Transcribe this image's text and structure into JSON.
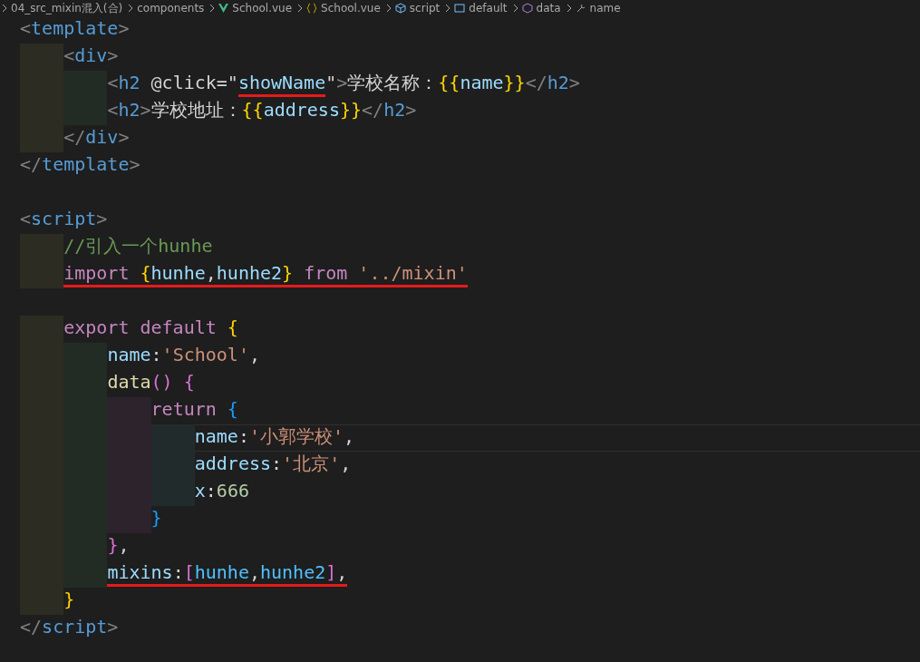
{
  "breadcrumb": [
    {
      "kind": "folder",
      "label": "04_src_mixin混入(合)"
    },
    {
      "kind": "folder",
      "label": "components"
    },
    {
      "kind": "vue",
      "label": "School.vue"
    },
    {
      "kind": "braces",
      "label": "School.vue"
    },
    {
      "kind": "module",
      "label": "script"
    },
    {
      "kind": "object",
      "label": "default"
    },
    {
      "kind": "method",
      "label": "data"
    },
    {
      "kind": "field",
      "label": "name"
    }
  ],
  "lines": [
    {
      "current": false,
      "tokens": [
        {
          "kind": "punct-tag",
          "text": "<"
        },
        {
          "kind": "tag",
          "text": "template"
        },
        {
          "kind": "punct-tag",
          "text": ">"
        }
      ],
      "children": [
        {
          "current": false,
          "tokens": [
            {
              "kind": "punct-tag",
              "text": "<"
            },
            {
              "kind": "tag",
              "text": "div"
            },
            {
              "kind": "punct-tag",
              "text": ">"
            }
          ],
          "children": [
            {
              "current": false,
              "tokens": [
                {
                  "kind": "punct-tag",
                  "text": "<",
                  "underlined": false
                },
                {
                  "kind": "tag",
                  "text": "h2 ",
                  "underlined": false
                },
                {
                  "kind": "plain",
                  "text": "@click=\"",
                  "underlined": false
                },
                {
                  "kind": "attr",
                  "text": "showName",
                  "underlined": true
                },
                {
                  "kind": "plain",
                  "text": "\"",
                  "underlined": false
                },
                {
                  "kind": "punct-tag",
                  "text": ">",
                  "underlined": false
                },
                {
                  "kind": "plain",
                  "text": "学校名称：",
                  "underlined": false
                },
                {
                  "kind": "gold",
                  "text": "{{",
                  "underlined": false
                },
                {
                  "kind": "attr",
                  "text": "name",
                  "underlined": false
                },
                {
                  "kind": "gold",
                  "text": "}}",
                  "underlined": false
                },
                {
                  "kind": "punct-tag",
                  "text": "</",
                  "underlined": false
                },
                {
                  "kind": "tag",
                  "text": "h2",
                  "underlined": false
                },
                {
                  "kind": "punct-tag",
                  "text": ">",
                  "underlined": false
                }
              ]
            },
            {
              "current": false,
              "tokens": [
                {
                  "kind": "punct-tag",
                  "text": "<"
                },
                {
                  "kind": "tag",
                  "text": "h2"
                },
                {
                  "kind": "punct-tag",
                  "text": ">"
                },
                {
                  "kind": "plain",
                  "text": "学校地址："
                },
                {
                  "kind": "gold",
                  "text": "{{"
                },
                {
                  "kind": "attr",
                  "text": "address"
                },
                {
                  "kind": "gold",
                  "text": "}}"
                },
                {
                  "kind": "punct-tag",
                  "text": "</"
                },
                {
                  "kind": "tag",
                  "text": "h2"
                },
                {
                  "kind": "punct-tag",
                  "text": ">"
                }
              ]
            }
          ]
        },
        {
          "current": false,
          "tokens": [
            {
              "kind": "punct-tag",
              "text": "</"
            },
            {
              "kind": "tag",
              "text": "div"
            },
            {
              "kind": "punct-tag",
              "text": ">"
            }
          ]
        }
      ]
    },
    {
      "current": false,
      "tokens": [
        {
          "kind": "punct-tag",
          "text": "</"
        },
        {
          "kind": "tag",
          "text": "template"
        },
        {
          "kind": "punct-tag",
          "text": ">"
        }
      ]
    },
    {
      "current": false
    },
    {
      "current": false,
      "tokens": [
        {
          "kind": "punct-tag",
          "text": "<"
        },
        {
          "kind": "tag",
          "text": "script"
        },
        {
          "kind": "punct-tag",
          "text": ">"
        }
      ],
      "children": [
        {
          "current": false,
          "tokens": [
            {
              "kind": "comment",
              "text": "//引入一个hunhe"
            }
          ]
        },
        {
          "current": false,
          "tokens": [
            {
              "kind": "keyword",
              "text": "import ",
              "underlined": true
            },
            {
              "kind": "gold",
              "text": "{",
              "underlined": true
            },
            {
              "kind": "attr",
              "text": "hunhe",
              "underlined": true
            },
            {
              "kind": "plain",
              "text": ",",
              "underlined": true
            },
            {
              "kind": "attr",
              "text": "hunhe2",
              "underlined": true
            },
            {
              "kind": "gold",
              "text": "}",
              "underlined": true
            },
            {
              "kind": "keyword",
              "text": " from ",
              "underlined": true
            },
            {
              "kind": "string",
              "text": "'../mixin'",
              "underlined": true
            }
          ]
        }
      ]
    },
    {
      "current": false
    },
    {
      "current": false,
      "tokens": [
        {
          "kind": "keyword",
          "text": "export default "
        },
        {
          "kind": "gold",
          "text": "{"
        }
      ],
      "indented": true,
      "children": [
        {
          "current": false,
          "tokens": [
            {
              "kind": "attr",
              "text": "name"
            },
            {
              "kind": "plain",
              "text": ":"
            },
            {
              "kind": "string",
              "text": "'School'"
            },
            {
              "kind": "plain",
              "text": ","
            }
          ]
        },
        {
          "current": false,
          "tokens": [
            {
              "kind": "function",
              "text": "data"
            },
            {
              "kind": "purple",
              "text": "() {"
            }
          ],
          "children": [
            {
              "current": false,
              "tokens": [
                {
                  "kind": "keyword",
                  "text": "return "
                },
                {
                  "kind": "blue",
                  "text": "{"
                }
              ],
              "children": [
                {
                  "current": true,
                  "tokens": [
                    {
                      "kind": "attr",
                      "text": "name"
                    },
                    {
                      "kind": "plain",
                      "text": ":"
                    },
                    {
                      "kind": "string",
                      "text": "'小郭学校'"
                    },
                    {
                      "kind": "plain",
                      "text": ","
                    }
                  ]
                },
                {
                  "current": false,
                  "tokens": [
                    {
                      "kind": "attr",
                      "text": "address"
                    },
                    {
                      "kind": "plain",
                      "text": ":"
                    },
                    {
                      "kind": "string",
                      "text": "'北京'"
                    },
                    {
                      "kind": "plain",
                      "text": ","
                    }
                  ]
                },
                {
                  "current": false,
                  "tokens": [
                    {
                      "kind": "attr",
                      "text": "x"
                    },
                    {
                      "kind": "plain",
                      "text": ":"
                    },
                    {
                      "kind": "number",
                      "text": "666"
                    }
                  ]
                }
              ]
            },
            {
              "current": false,
              "tokens": [
                {
                  "kind": "blue",
                  "text": "}"
                }
              ]
            }
          ]
        },
        {
          "current": false,
          "tokens": [
            {
              "kind": "purple",
              "text": "}"
            },
            {
              "kind": "plain",
              "text": ","
            }
          ]
        },
        {
          "current": false,
          "tokens": [
            {
              "kind": "attr",
              "text": "mixins",
              "underlined": true
            },
            {
              "kind": "plain",
              "text": ":",
              "underlined": true
            },
            {
              "kind": "purple",
              "text": "[",
              "underlined": true
            },
            {
              "kind": "bright",
              "text": "hunhe",
              "underlined": true
            },
            {
              "kind": "plain",
              "text": ",",
              "underlined": true
            },
            {
              "kind": "bright",
              "text": "hunhe2",
              "underlined": true
            },
            {
              "kind": "purple",
              "text": "]",
              "underlined": true
            },
            {
              "kind": "plain",
              "text": ",",
              "underlined": true
            }
          ]
        }
      ]
    },
    {
      "current": false,
      "tokens": [
        {
          "kind": "gold",
          "text": "}"
        }
      ],
      "indented": true
    },
    {
      "current": false,
      "tokens": [
        {
          "kind": "punct-tag",
          "text": "</"
        },
        {
          "kind": "tag",
          "text": "script"
        },
        {
          "kind": "punct-tag",
          "text": ">"
        }
      ]
    }
  ]
}
